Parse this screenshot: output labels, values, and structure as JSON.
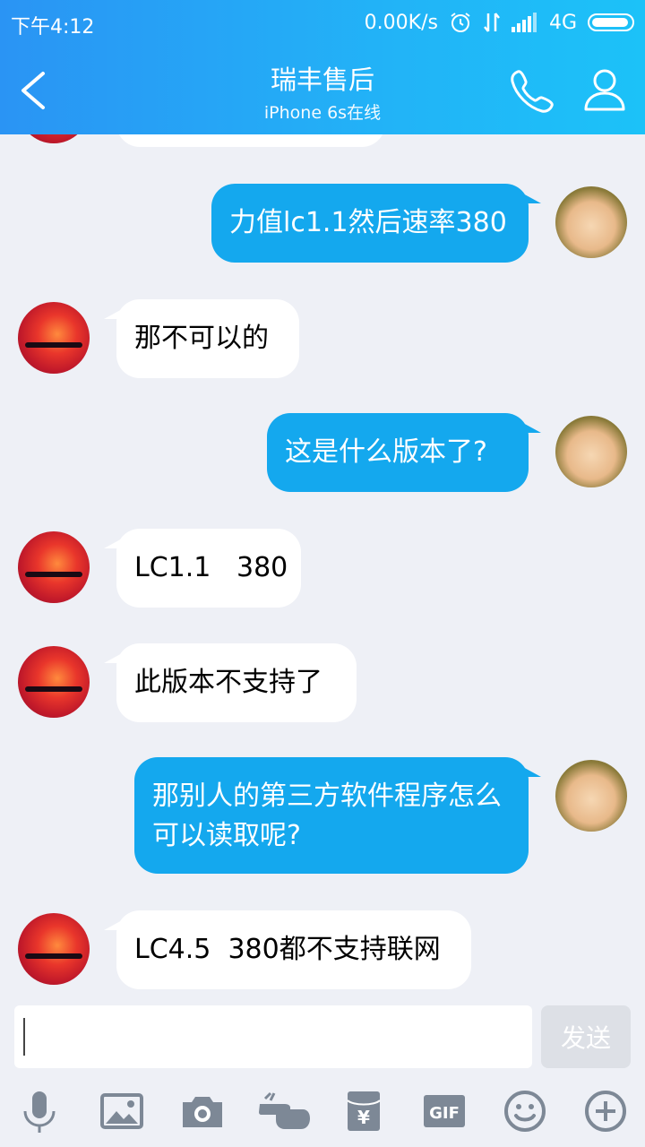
{
  "status_bar": {
    "time": "下午4:12",
    "speed": "0.00K/s",
    "network": "4G"
  },
  "header": {
    "title": "瑞丰售后",
    "subtitle": "iPhone 6s在线"
  },
  "messages": [
    {
      "side": "out",
      "text": "力值lc1.1然后速率380"
    },
    {
      "side": "in",
      "text": "那不可以的"
    },
    {
      "side": "out",
      "text": "这是什么版本了?"
    },
    {
      "side": "in",
      "text": "LC1.1   380"
    },
    {
      "side": "in",
      "text": "此版本不支持了"
    },
    {
      "side": "out",
      "text": "那别人的第三方软件程序怎么可以读取呢?"
    },
    {
      "side": "in",
      "text": "LC4.5  380都不支持联网"
    }
  ],
  "input": {
    "value": "",
    "send_label": "发送"
  },
  "toolbar": {
    "icons": [
      "microphone-icon",
      "image-icon",
      "camera-icon",
      "poke-icon",
      "red-envelope-icon",
      "gif-icon",
      "emoji-icon",
      "plus-icon"
    ],
    "gif_label": "GIF",
    "red_envelope_label": "¥"
  },
  "colors": {
    "header": "#22b3f7",
    "out_bubble": "#14a8ee",
    "in_bubble": "#ffffff",
    "background": "#eef0f6"
  }
}
